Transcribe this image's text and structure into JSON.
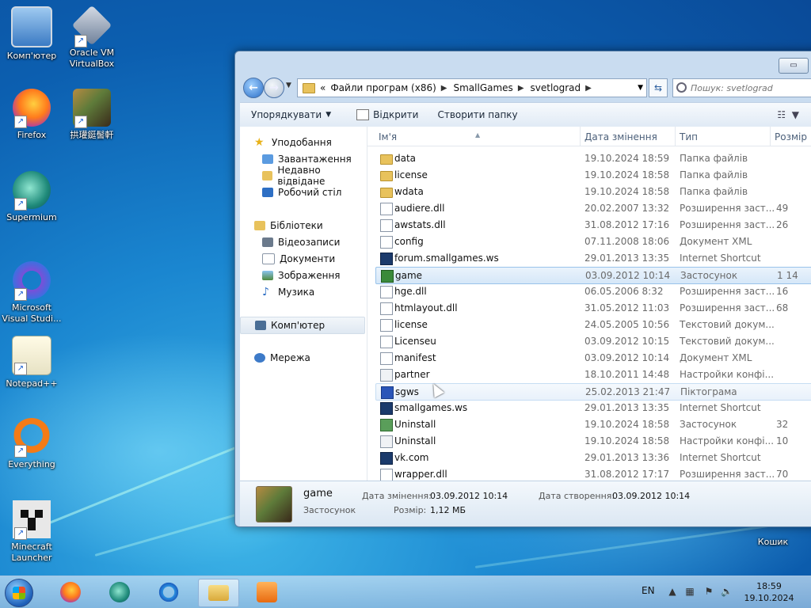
{
  "desktop": {
    "icons": [
      {
        "label": "Комп'ютер"
      },
      {
        "label": "Oracle VM VirtualBox"
      },
      {
        "label": "Firefox"
      },
      {
        "label": "拱瓘鋌髻軒"
      },
      {
        "label": "Supermium"
      },
      {
        "label": "Microsoft Visual Studi..."
      },
      {
        "label": "Notepad++"
      },
      {
        "label": "Everything"
      },
      {
        "label": "Minecraft Launcher"
      },
      {
        "label": "Кошик"
      }
    ]
  },
  "explorer": {
    "address": {
      "crumbs": [
        "«",
        "Файли програм (x86)",
        "SmallGames",
        "svetlograd"
      ],
      "search_placeholder": "Пошук: svetlograd"
    },
    "toolbar": {
      "organize": "Упорядкувати",
      "open": "Відкрити",
      "new_folder": "Створити папку"
    },
    "nav": {
      "favorites": "Уподобання",
      "downloads": "Завантаження",
      "recent": "Недавно відвідане",
      "desktop": "Робочий стіл",
      "libraries": "Бібліотеки",
      "videos": "Відеозаписи",
      "documents": "Документи",
      "pictures": "Зображення",
      "music": "Музика",
      "computer": "Комп'ютер",
      "network": "Мережа"
    },
    "columns": {
      "name": "Ім'я",
      "date": "Дата змінення",
      "type": "Тип",
      "size": "Розмір"
    },
    "files": [
      {
        "name": "data",
        "date": "19.10.2024 18:59",
        "type": "Папка файлів",
        "size": "",
        "icon": "folder-icon"
      },
      {
        "name": "license",
        "date": "19.10.2024 18:58",
        "type": "Папка файлів",
        "size": "",
        "icon": "folder-icon"
      },
      {
        "name": "wdata",
        "date": "19.10.2024 18:58",
        "type": "Папка файлів",
        "size": "",
        "icon": "folder-icon"
      },
      {
        "name": "audiere.dll",
        "date": "20.02.2007 13:32",
        "type": "Розширення заст...",
        "size": "49",
        "icon": "dll-icon"
      },
      {
        "name": "awstats.dll",
        "date": "31.08.2012 17:16",
        "type": "Розширення заст...",
        "size": "26",
        "icon": "dll-icon"
      },
      {
        "name": "config",
        "date": "07.11.2008 18:06",
        "type": "Документ XML",
        "size": "",
        "icon": "xml-icon"
      },
      {
        "name": "forum.smallgames.ws",
        "date": "29.01.2013 13:35",
        "type": "Internet Shortcut",
        "size": "",
        "icon": "url-icon"
      },
      {
        "name": "game",
        "date": "03.09.2012 10:14",
        "type": "Застосунок",
        "size": "1 14",
        "icon": "exe-icon"
      },
      {
        "name": "hge.dll",
        "date": "06.05.2006 8:32",
        "type": "Розширення заст...",
        "size": "16",
        "icon": "dll-icon"
      },
      {
        "name": "htmlayout.dll",
        "date": "31.05.2012 11:03",
        "type": "Розширення заст...",
        "size": "68",
        "icon": "dll-icon"
      },
      {
        "name": "license",
        "date": "24.05.2005 10:56",
        "type": "Текстовий докум...",
        "size": "",
        "icon": "txt-icon"
      },
      {
        "name": "Licenseu",
        "date": "03.09.2012 10:15",
        "type": "Текстовий докум...",
        "size": "",
        "icon": "txt-icon"
      },
      {
        "name": "manifest",
        "date": "03.09.2012 10:14",
        "type": "Документ XML",
        "size": "",
        "icon": "xml-icon"
      },
      {
        "name": "partner",
        "date": "18.10.2011 14:48",
        "type": "Настройки конфі...",
        "size": "",
        "icon": "ini-icon"
      },
      {
        "name": "sgws",
        "date": "25.02.2013 21:47",
        "type": "Піктограма",
        "size": "",
        "icon": "ico-icon"
      },
      {
        "name": "smallgames.ws",
        "date": "29.01.2013 13:35",
        "type": "Internet Shortcut",
        "size": "",
        "icon": "url-icon"
      },
      {
        "name": "Uninstall",
        "date": "19.10.2024 18:58",
        "type": "Застосунок",
        "size": "32",
        "icon": "uninstall-icon"
      },
      {
        "name": "Uninstall",
        "date": "19.10.2024 18:58",
        "type": "Настройки конфі...",
        "size": "10",
        "icon": "ini-icon"
      },
      {
        "name": "vk.com",
        "date": "29.01.2013 13:36",
        "type": "Internet Shortcut",
        "size": "",
        "icon": "url-icon"
      },
      {
        "name": "wrapper.dll",
        "date": "31.08.2012 17:17",
        "type": "Розширення заст...",
        "size": "70",
        "icon": "dll-icon"
      }
    ],
    "details": {
      "name": "game",
      "type": "Застосунок",
      "modified_label": "Дата змінення:",
      "modified_value": "03.09.2012 10:14",
      "created_label": "Дата створення:",
      "created_value": "03.09.2012 10:14",
      "size_label": "Розмір:",
      "size_value": "1,12 МБ"
    }
  },
  "taskbar": {
    "lang": "EN",
    "time": "18:59",
    "date": "19.10.2024"
  }
}
